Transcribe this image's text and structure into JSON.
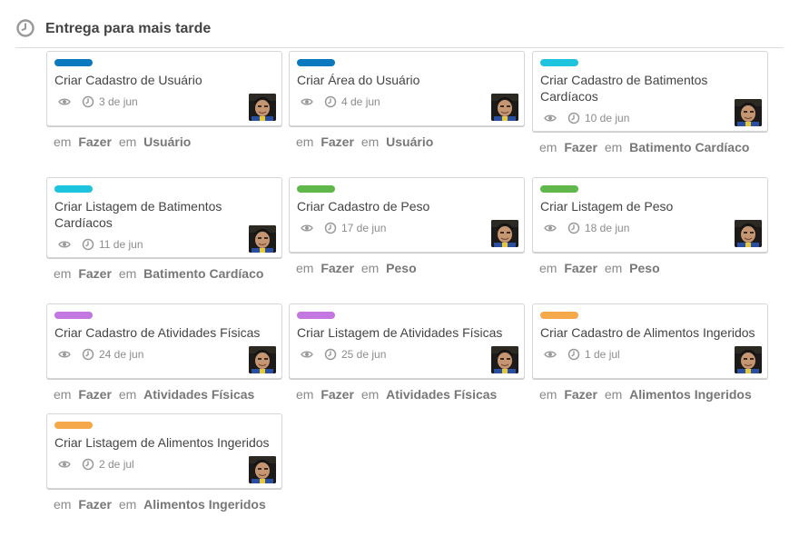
{
  "section": {
    "title": "Entrega para mais tarde"
  },
  "meta_words": {
    "prefix": "em",
    "between": "em"
  },
  "cards": [
    {
      "title": "Criar Cadastro de Usuário",
      "due": "3 de jun",
      "label_color": "#0a79bf",
      "list": "Fazer",
      "board": "Usuário"
    },
    {
      "title": "Criar Área do Usuário",
      "due": "4 de jun",
      "label_color": "#0a79bf",
      "list": "Fazer",
      "board": "Usuário"
    },
    {
      "title": "Criar Cadastro de Batimentos Cardíacos",
      "due": "10 de jun",
      "label_color": "#1ec3dd",
      "list": "Fazer",
      "board": "Batimento Cardíaco"
    },
    {
      "title": "Criar Listagem de Batimentos Cardíacos",
      "due": "11 de jun",
      "label_color": "#1ec3dd",
      "list": "Fazer",
      "board": "Batimento Cardíaco"
    },
    {
      "title": "Criar Cadastro de Peso",
      "due": "17 de jun",
      "label_color": "#5fb849",
      "list": "Fazer",
      "board": "Peso"
    },
    {
      "title": "Criar Listagem de Peso",
      "due": "18 de jun",
      "label_color": "#5fb849",
      "list": "Fazer",
      "board": "Peso"
    },
    {
      "title": "Criar Cadastro de Atividades Físicas",
      "due": "24 de jun",
      "label_color": "#c377e0",
      "list": "Fazer",
      "board": "Atividades Físicas"
    },
    {
      "title": "Criar Listagem de Atividades Físicas",
      "due": "25 de jun",
      "label_color": "#c377e0",
      "list": "Fazer",
      "board": "Atividades Físicas"
    },
    {
      "title": "Criar Cadastro de Alimentos Ingeridos",
      "due": "1 de jul",
      "label_color": "#f5a94a",
      "list": "Fazer",
      "board": "Alimentos Ingeridos"
    },
    {
      "title": "Criar Listagem de Alimentos Ingeridos",
      "due": "2 de jul",
      "label_color": "#f5a94a",
      "list": "Fazer",
      "board": "Alimentos Ingeridos"
    }
  ]
}
